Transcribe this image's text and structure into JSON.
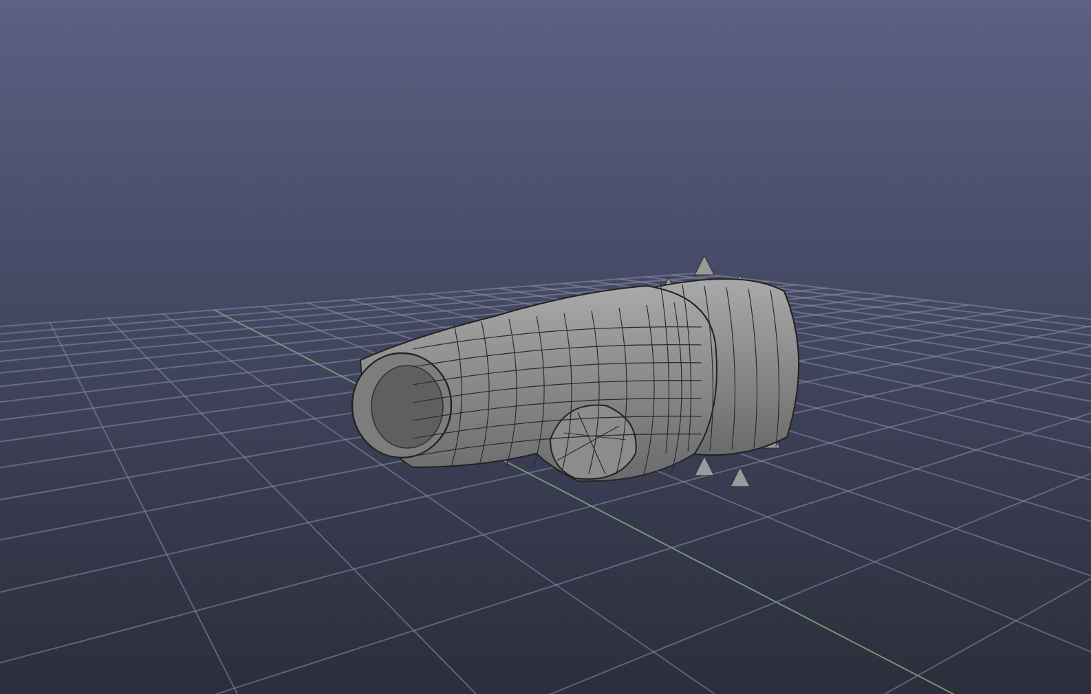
{
  "viewport": {
    "grid": true,
    "wireframe": true
  }
}
